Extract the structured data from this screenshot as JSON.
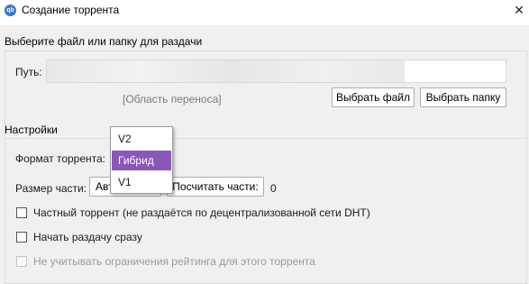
{
  "window": {
    "title": "Создание торрента",
    "app_icon_text": "qb",
    "close_glyph": "✕"
  },
  "source": {
    "group_title": "Выберите файл или папку для раздачи",
    "path_label": "Путь:",
    "path_value": "",
    "drop_area": "[Область переноса]",
    "select_file_button": "Выбрать файл",
    "select_folder_button": "Выбрать папку"
  },
  "settings": {
    "group_title": "Настройки",
    "format_label": "Формат торрента:",
    "piece_size_label": "Размер части:",
    "piece_size_value": "Авто",
    "calculate_pieces_button": "Посчитать части:",
    "pieces_count": "0",
    "private_torrent": {
      "label": "Частный торрент (не раздаётся по децентрализованной сети DHT)",
      "checked": false,
      "enabled": true
    },
    "start_seeding": {
      "label": "Начать раздачу сразу",
      "checked": false,
      "enabled": true
    },
    "ignore_ratio": {
      "label": "Не учитывать ограничения рейтинга для этого торрента",
      "checked": false,
      "enabled": false
    }
  },
  "format_dropdown": {
    "options": [
      "V2",
      "Гибрид",
      "V1"
    ],
    "selected": "Гибрид",
    "highlight_color": "#8a57b9"
  }
}
